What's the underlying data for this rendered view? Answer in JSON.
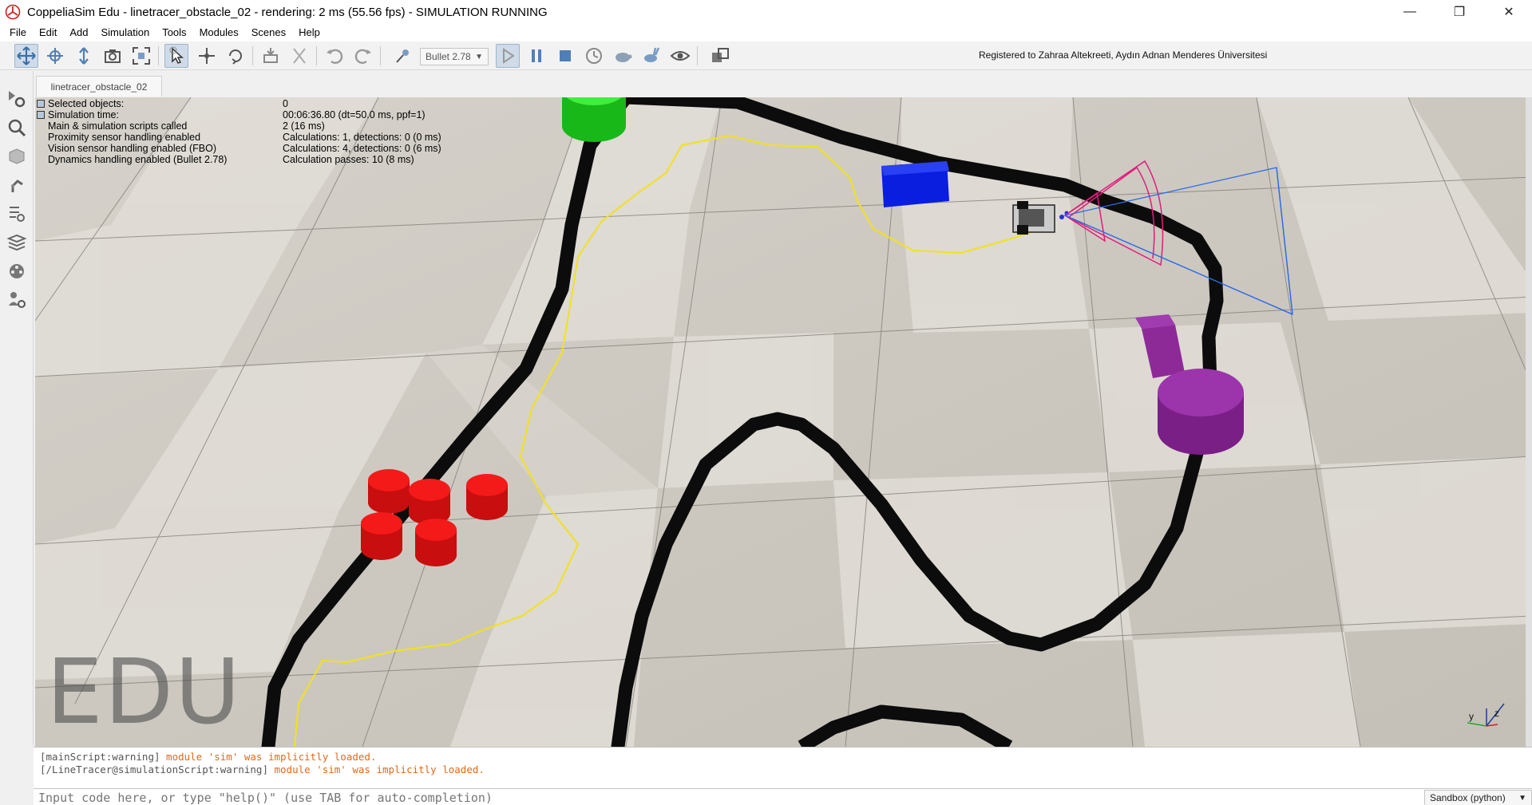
{
  "window": {
    "title": "CoppeliaSim Edu - linetracer_obstacle_02 - rendering: 2 ms (55.56 fps) - SIMULATION RUNNING",
    "minimize": "—",
    "maximize": "❐",
    "close": "✕"
  },
  "menu": {
    "items": [
      "File",
      "Edit",
      "Add",
      "Simulation",
      "Tools",
      "Modules",
      "Scenes",
      "Help"
    ]
  },
  "toolbar": {
    "engine": "Bullet 2.78",
    "registered": "Registered to Zahraa Altekreeti, Aydın Adnan Menderes Üniversitesi"
  },
  "scene_tab": {
    "label": "linetracer_obstacle_02"
  },
  "info_overlay": {
    "rows": [
      {
        "label": "Selected objects:",
        "value": "0"
      },
      {
        "label": "Simulation time:",
        "value": "00:06:36.80 (dt=50.0 ms, ppf=1)"
      },
      {
        "label": "Main & simulation scripts called",
        "value": "2 (16 ms)"
      },
      {
        "label": "Proximity sensor handling enabled",
        "value": "Calculations: 1, detections: 0 (0 ms)"
      },
      {
        "label": "Vision sensor handling enabled (FBO)",
        "value": "Calculations: 4, detections: 0 (6 ms)"
      },
      {
        "label": "Dynamics handling enabled (Bullet 2.78)",
        "value": "Calculation passes: 10 (8 ms)"
      }
    ]
  },
  "viewport": {
    "watermark": "EDU",
    "axis_labels": {
      "y": "y",
      "z": "z"
    }
  },
  "console": {
    "lines": [
      {
        "tag": "[mainScript:warning]",
        "message": "module 'sim' was implicitly loaded."
      },
      {
        "tag": "[/LineTracer@simulationScript:warning]",
        "message": "module 'sim' was implicitly loaded."
      }
    ]
  },
  "command": {
    "placeholder": "Input code here, or type \"help()\" (use TAB for auto-completion)",
    "sandbox": "Sandbox (python)"
  },
  "colors": {
    "accent_running": "#cfdbe8",
    "console_warning": "#e06a1a",
    "obstacle_green": "#22d322",
    "obstacle_blue": "#0a1ee0",
    "obstacle_purple": "#8e2a98",
    "obstacle_red": "#ee1010",
    "trace_yellow": "#f2e21a"
  }
}
